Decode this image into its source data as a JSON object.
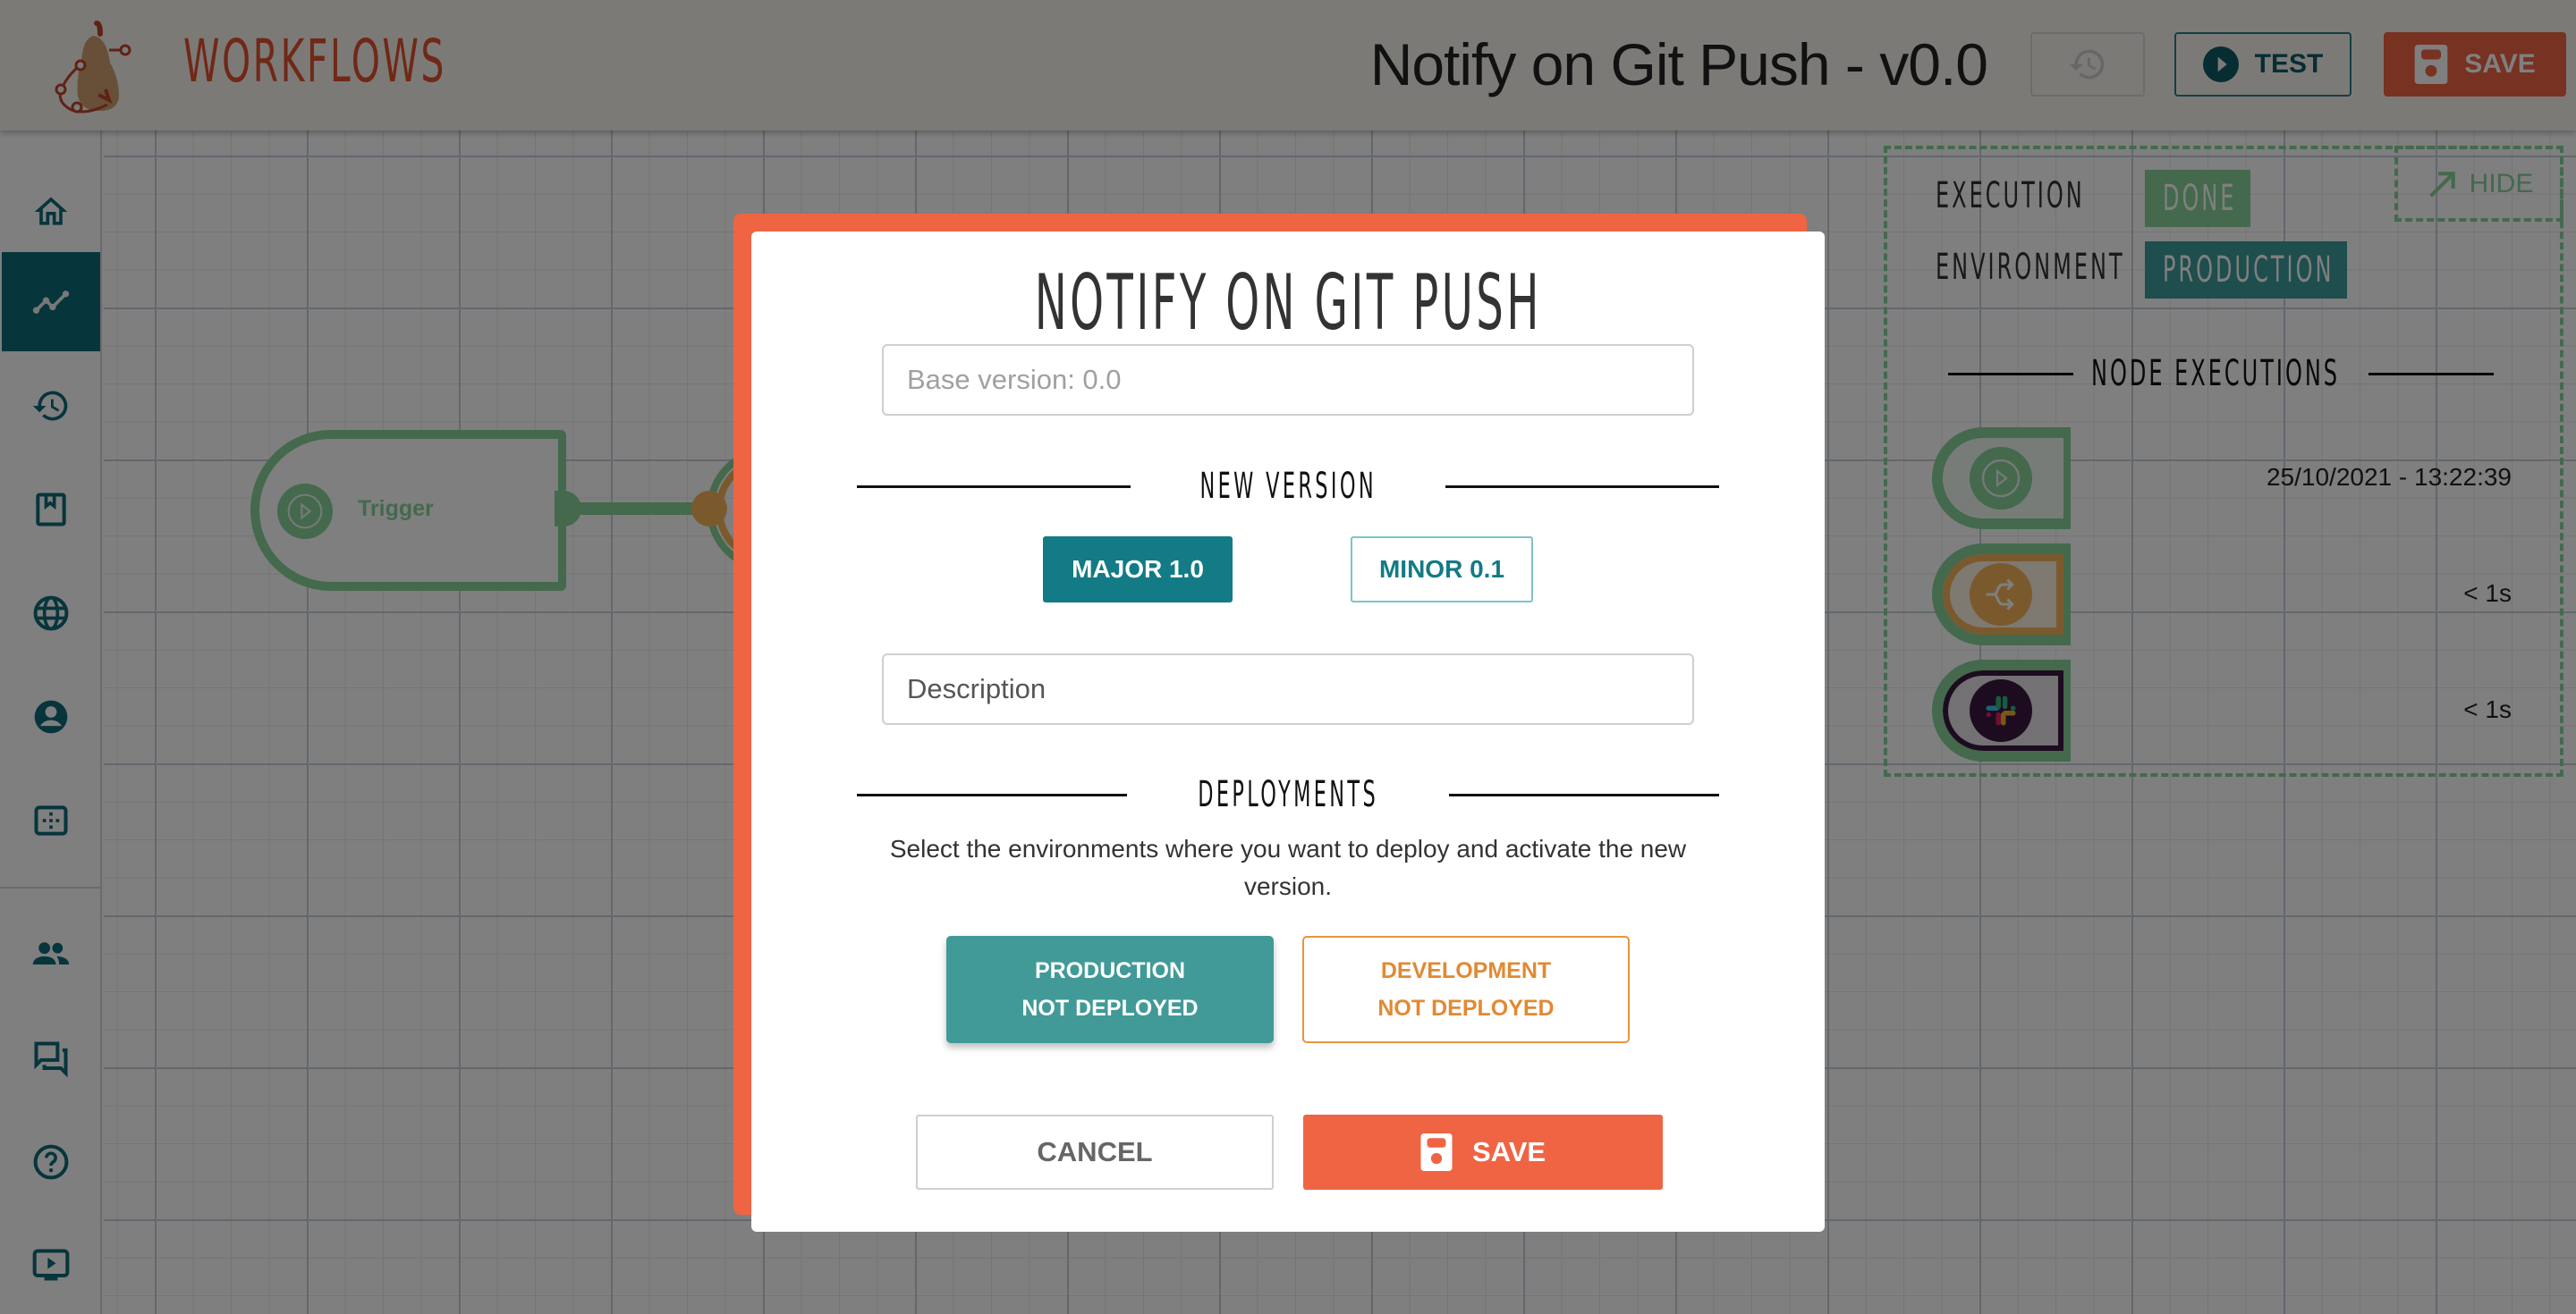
{
  "header": {
    "brand": "WORKFLOWS",
    "workflow_title": "Notify on Git Push - v0.0",
    "history_icon": "history-icon",
    "test_label": "TEST",
    "save_label": "SAVE"
  },
  "sidebar": {
    "items": [
      {
        "name": "home",
        "icon": "home-icon",
        "active": false
      },
      {
        "name": "workflows",
        "icon": "chart-line-icon",
        "active": true
      },
      {
        "name": "history",
        "icon": "history-icon",
        "active": false
      },
      {
        "name": "library",
        "icon": "bookmark-book-icon",
        "active": false
      },
      {
        "name": "environments",
        "icon": "globe-icon",
        "active": false
      },
      {
        "name": "account",
        "icon": "user-circle-icon",
        "active": false
      },
      {
        "name": "nodes",
        "icon": "dots-grid-icon",
        "active": false
      },
      {
        "name": "team",
        "icon": "people-icon",
        "active": false
      },
      {
        "name": "forum",
        "icon": "chat-icon",
        "active": false
      },
      {
        "name": "help",
        "icon": "help-circle-icon",
        "active": false
      },
      {
        "name": "tutorials",
        "icon": "video-play-icon",
        "active": false
      }
    ]
  },
  "canvas": {
    "trigger_node_label": "Trigger"
  },
  "execution_panel": {
    "hide_label": "HIDE",
    "execution_label": "EXECUTION",
    "execution_status": "DONE",
    "environment_label": "ENVIRONMENT",
    "environment_value": "PRODUCTION",
    "node_executions_title": "NODE EXECUTIONS",
    "node_executions": [
      {
        "node": "trigger",
        "icon": "play-circle-icon",
        "time": "25/10/2021 - 13:22:39"
      },
      {
        "node": "branch",
        "icon": "branch-arrows-icon",
        "time": "< 1s"
      },
      {
        "node": "slack",
        "icon": "slack-icon",
        "time": "< 1s"
      }
    ]
  },
  "modal": {
    "title": "NOTIFY ON GIT PUSH",
    "base_version_placeholder": "Base version: 0.0",
    "new_version_title": "NEW VERSION",
    "major_label": "MAJOR 1.0",
    "minor_label": "MINOR 0.1",
    "selected_version": "MAJOR 1.0",
    "description_placeholder": "Description",
    "description_value": "",
    "deployments_title": "DEPLOYMENTS",
    "deployments_text": "Select the environments where you want to deploy and activate the new version.",
    "environments": [
      {
        "name": "PRODUCTION",
        "status": "NOT DEPLOYED",
        "selected": true
      },
      {
        "name": "DEVELOPMENT",
        "status": "NOT DEPLOYED",
        "selected": false
      }
    ],
    "cancel_label": "CANCEL",
    "save_label": "SAVE"
  },
  "colors": {
    "brand_red": "#ef6443",
    "teal_dark": "#0e6a78",
    "teal": "#127b85",
    "teal_env": "#419a97",
    "green_node": "#88d29a",
    "orange_dev": "#e8953e"
  }
}
